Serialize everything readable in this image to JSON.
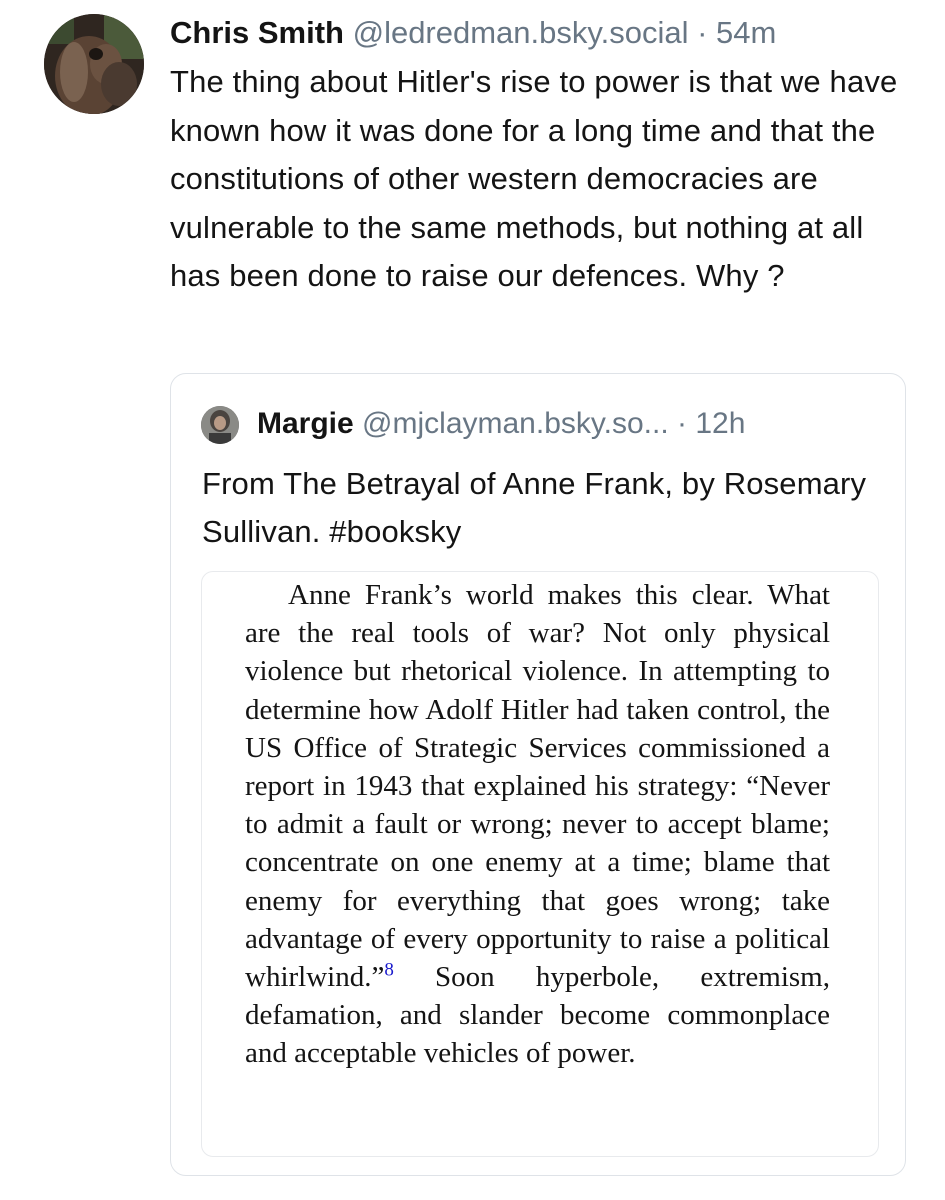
{
  "post": {
    "author_name": "Chris Smith",
    "author_handle": "@ledredman.bsky.social",
    "separator": "·",
    "time": "54m",
    "body": "The thing about Hitler's rise to power is that we have known how it was done for a long time and that the constitutions of other western democracies are vulnerable to the same methods, but nothing at all has been done to raise our defences. Why ?"
  },
  "quote": {
    "author_name": "Margie",
    "author_handle": "@mjclayman.bsky.so...",
    "separator": "·",
    "time": "12h",
    "body": "From The Betrayal of Anne Frank, by Rosemary Sullivan. #booksky",
    "book_excerpt": {
      "text_before": "Anne Frank’s world makes this clear. What are the real tools of war? Not only physical violence but rhetorical violence. In attempting to determine how Adolf Hitler had taken control, the US Office of Strategic Services commissioned a report in 1943 that explained his strategy: “Never to admit a fault or wrong; never to accept blame; concentrate on one enemy at a time; blame that enemy for everything that goes wrong; take advantage of every opportunity to raise a political whirlwind.”",
      "footnote": "8",
      "text_after": " Soon hyperbole, extremism, defamation, and slander become commonplace and acceptable vehicles of power."
    }
  }
}
